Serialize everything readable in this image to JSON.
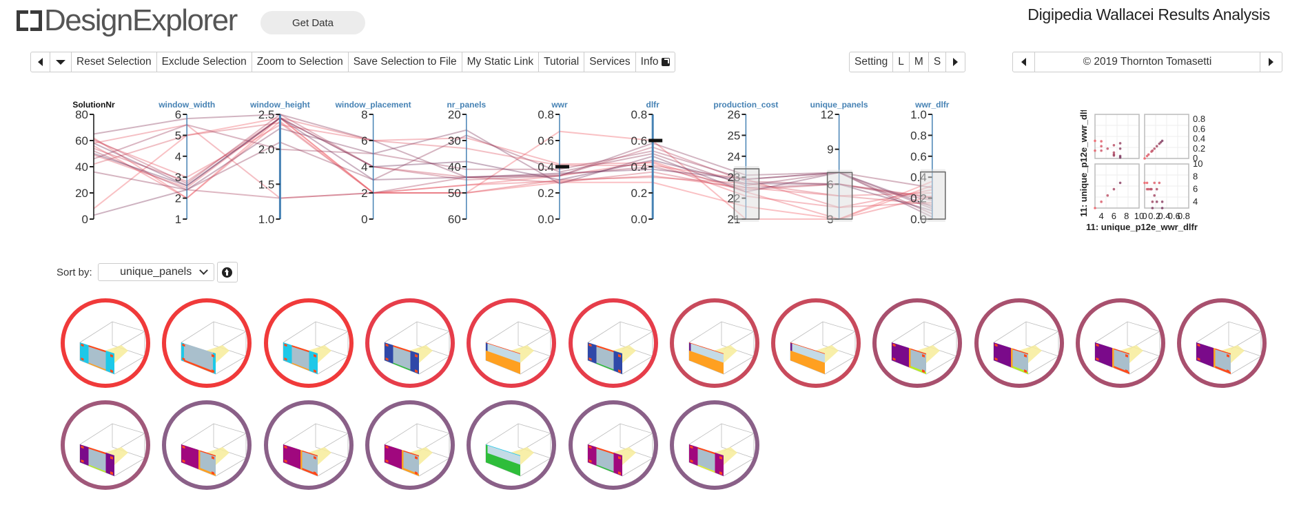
{
  "header": {
    "logo_text": "DesignExplorer",
    "get_data_label": "Get Data",
    "title": "Digipedia Wallacei Results Analysis"
  },
  "toolbar": {
    "items": [
      {
        "name": "prev-button",
        "icon": "triangle-left-icon",
        "label": ""
      },
      {
        "name": "dropdown-button",
        "icon": "triangle-down-icon",
        "label": ""
      },
      {
        "name": "reset-selection-button",
        "label": "Reset Selection"
      },
      {
        "name": "exclude-selection-button",
        "label": "Exclude Selection"
      },
      {
        "name": "zoom-to-selection-button",
        "label": "Zoom to Selection"
      },
      {
        "name": "save-selection-button",
        "label": "Save Selection to File"
      },
      {
        "name": "static-link-button",
        "label": "My Static Link"
      },
      {
        "name": "tutorial-button",
        "label": "Tutorial"
      },
      {
        "name": "services-button",
        "label": "Services"
      },
      {
        "name": "info-button",
        "label": "Info",
        "icon": "external-link-icon"
      }
    ],
    "settings": {
      "setting_label": "Setting",
      "sizes": [
        "L",
        "M",
        "S"
      ]
    },
    "credits": {
      "text": "© 2019 Thornton Tomasetti"
    }
  },
  "chart_data": [
    {
      "type": "parallel-coordinates",
      "axes": [
        {
          "name": "SolutionNr",
          "ticks": [
            "0",
            "20",
            "40",
            "60",
            "80"
          ],
          "range": [
            0,
            80
          ],
          "inverted": false,
          "brush": null
        },
        {
          "name": "window_width",
          "ticks": [
            "1",
            "2",
            "3",
            "4",
            "5",
            "6"
          ],
          "range": [
            1,
            6
          ],
          "inverted": false,
          "brush": null
        },
        {
          "name": "window_height",
          "ticks": [
            "1.0",
            "1.5",
            "2.0",
            "2.5"
          ],
          "range": [
            1.0,
            2.5
          ],
          "inverted": false,
          "brush": null
        },
        {
          "name": "window_placement",
          "ticks": [
            "0",
            "2",
            "4",
            "6",
            "8"
          ],
          "range": [
            0,
            8
          ],
          "inverted": false,
          "brush": null
        },
        {
          "name": "nr_panels",
          "ticks": [
            "60",
            "50",
            "40",
            "30",
            "20"
          ],
          "range": [
            60,
            20
          ],
          "inverted": true,
          "brush": null
        },
        {
          "name": "wwr",
          "ticks": [
            "0.0",
            "0.2",
            "0.4",
            "0.6",
            "0.8"
          ],
          "range": [
            0,
            0.8
          ],
          "inverted": false,
          "brush": null,
          "marker": 0.4
        },
        {
          "name": "dlfr",
          "ticks": [
            "0.0",
            "0.2",
            "0.4",
            "0.6",
            "0.8"
          ],
          "range": [
            0,
            0.8
          ],
          "inverted": false,
          "brush": null,
          "marker": 0.6
        },
        {
          "name": "production_cost",
          "ticks": [
            "21",
            "22",
            "23",
            "24",
            "25",
            "26"
          ],
          "range": [
            21,
            26
          ],
          "inverted": false,
          "brush": [
            21,
            23.4
          ]
        },
        {
          "name": "unique_panels",
          "ticks": [
            "3",
            "6",
            "9",
            "12"
          ],
          "range": [
            3,
            12
          ],
          "inverted": false,
          "brush": [
            3,
            7
          ]
        },
        {
          "name": "wwr_dlfr",
          "ticks": [
            "0.0",
            "0.2",
            "0.4",
            "0.6",
            "0.8",
            "1.0"
          ],
          "range": [
            0,
            1
          ],
          "inverted": false,
          "brush": [
            0,
            0.45
          ]
        }
      ],
      "series": [
        {
          "rank": 0.0,
          "values": [
            62,
            2.0,
            2.45,
            2.0,
            50,
            0.28,
            0.28,
            21.6,
            3,
            0.36
          ]
        },
        {
          "rank": 0.02,
          "values": [
            8,
            5.0,
            2.45,
            2.0,
            50,
            0.67,
            0.6,
            21.0,
            3,
            0.32
          ]
        },
        {
          "rank": 0.05,
          "values": [
            56,
            2.0,
            2.4,
            2.0,
            47,
            0.33,
            0.44,
            22.3,
            3,
            0.22
          ]
        },
        {
          "rank": 0.08,
          "values": [
            60,
            3.0,
            2.35,
            6.0,
            29,
            0.42,
            0.43,
            22.1,
            4,
            0.28
          ]
        },
        {
          "rank": 0.1,
          "values": [
            58,
            5.5,
            1.3,
            2.0,
            47,
            0.29,
            0.33,
            22.5,
            5,
            0.25
          ]
        },
        {
          "rank": 0.14,
          "values": [
            49,
            2.5,
            2.45,
            6.0,
            33,
            0.41,
            0.41,
            22.9,
            4,
            0.16
          ]
        },
        {
          "rank": 0.2,
          "values": [
            42,
            5.0,
            2.38,
            2.0,
            50,
            0.3,
            0.32,
            22.7,
            5,
            0.14
          ]
        },
        {
          "rank": 0.3,
          "values": [
            54,
            2.8,
            2.45,
            4.0,
            44,
            0.28,
            0.36,
            22.4,
            6,
            0.21
          ]
        },
        {
          "rank": 0.45,
          "values": [
            61,
            2.7,
            2.5,
            4.0,
            45,
            0.33,
            0.55,
            22.8,
            6,
            0.2
          ]
        },
        {
          "rank": 0.55,
          "values": [
            52,
            2.4,
            1.3,
            2.0,
            44,
            0.34,
            0.4,
            22.5,
            6,
            0.18
          ]
        },
        {
          "rank": 0.62,
          "values": [
            46,
            5.5,
            2.0,
            5.0,
            41,
            0.38,
            0.52,
            22.9,
            7,
            0.05
          ]
        },
        {
          "rank": 0.7,
          "values": [
            36,
            2.4,
            2.1,
            3.0,
            28,
            0.36,
            0.5,
            22.6,
            7,
            0.3
          ]
        },
        {
          "rank": 0.78,
          "values": [
            65,
            5.8,
            2.5,
            6.0,
            44,
            0.33,
            0.58,
            23.1,
            7,
            0.1
          ]
        },
        {
          "rank": 0.85,
          "values": [
            3,
            2.4,
            2.3,
            5.0,
            26,
            0.27,
            0.48,
            22.3,
            7,
            0.02
          ]
        },
        {
          "rank": 0.92,
          "values": [
            58,
            2.6,
            2.45,
            3.0,
            44,
            0.35,
            0.38,
            22.9,
            7,
            0.12
          ]
        },
        {
          "rank": 1.0,
          "values": [
            50,
            2.6,
            2.45,
            4.0,
            38,
            0.3,
            0.45,
            22.7,
            6,
            0.08
          ]
        }
      ]
    },
    {
      "type": "scatter",
      "title": "scatter-plot-matrix",
      "x_labels": [
        "11: unique_p12e_wwr_dlfr"
      ],
      "y_labels": [
        "11: unique_p12e_wwr_dlfr"
      ],
      "x_ticks_left": [
        "4",
        "6",
        "8",
        "10"
      ],
      "x_ticks_right": [
        "0",
        "0.2",
        "0.4",
        "0.6",
        "0.8"
      ],
      "y_ticks_top": [
        "0",
        "0.2",
        "0.4",
        "0.6",
        "0.8"
      ],
      "y_ticks_bottom": [
        "4",
        "6",
        "8",
        "10"
      ],
      "panels": {
        "top_left": [
          [
            3,
            0.36
          ],
          [
            3,
            0.16
          ],
          [
            4,
            0.35
          ],
          [
            4,
            0.25
          ],
          [
            4,
            0.16
          ],
          [
            5,
            0.2
          ],
          [
            6,
            0.27
          ],
          [
            6,
            0.12
          ],
          [
            6,
            0.08
          ],
          [
            6,
            0.06
          ],
          [
            7,
            0.31
          ],
          [
            7,
            0.2
          ],
          [
            7,
            0.05
          ],
          [
            7,
            0.02
          ]
        ],
        "top_right": [
          [
            0,
            0
          ],
          [
            0.05,
            0.05
          ],
          [
            0.08,
            0.08
          ],
          [
            0.14,
            0.14
          ],
          [
            0.16,
            0.16
          ],
          [
            0.2,
            0.2
          ],
          [
            0.25,
            0.25
          ],
          [
            0.3,
            0.3
          ],
          [
            0.33,
            0.33
          ],
          [
            0.36,
            0.36
          ]
        ],
        "bottom_left": [
          [
            3,
            3
          ],
          [
            4,
            4
          ],
          [
            5,
            5
          ],
          [
            6,
            6
          ],
          [
            7,
            7
          ]
        ],
        "bottom_right": [
          [
            0,
            7
          ],
          [
            0.05,
            7
          ],
          [
            0.2,
            7
          ],
          [
            0.3,
            7
          ],
          [
            0.05,
            6
          ],
          [
            0.08,
            6
          ],
          [
            0.12,
            6
          ],
          [
            0.14,
            6
          ],
          [
            0.25,
            6
          ],
          [
            0.2,
            5
          ],
          [
            0.16,
            4
          ],
          [
            0.25,
            4
          ],
          [
            0.36,
            4
          ],
          [
            0.16,
            3
          ],
          [
            0.36,
            3
          ]
        ]
      }
    }
  ],
  "sort": {
    "label": "Sort by:",
    "selected": "unique_panels",
    "direction_icon": "arrow-circle-up-icon"
  },
  "thumbnails": [
    {
      "ring": "#f03a3a",
      "scheme": {
        "side": "#1ec8e8",
        "glass": "#a9bfcc",
        "accent": "#ff4a1a",
        "bottom": "#ffa020",
        "layout": "sides"
      }
    },
    {
      "ring": "#f03a3a",
      "scheme": {
        "side": "#1ec8e8",
        "glass": "#a9bfcc",
        "accent": "#ff4a1a",
        "bottom": "#ff4a1a",
        "layout": "full"
      }
    },
    {
      "ring": "#f03a3a",
      "scheme": {
        "side": "#1ec8e8",
        "glass": "#a9bfcc",
        "accent": "#ff4a1a",
        "bottom": "#ffa020",
        "layout": "sides"
      }
    },
    {
      "ring": "#e63d4a",
      "scheme": {
        "side": "#2f48a8",
        "glass": "#a9bfcc",
        "accent": "#ff4a1a",
        "bottom": "#2ebd3a",
        "layout": "sides"
      }
    },
    {
      "ring": "#e63d4a",
      "scheme": {
        "side": "#2f48a8",
        "glass": "#c4dbe6",
        "accent": "#ff4a1a",
        "bottom": "#ffa020",
        "layout": "lower"
      }
    },
    {
      "ring": "#e63d4a",
      "scheme": {
        "side": "#2f48a8",
        "glass": "#a9bfcc",
        "accent": "#ff4a1a",
        "bottom": "#2ebd3a",
        "layout": "sides"
      }
    },
    {
      "ring": "#c84a5c",
      "scheme": {
        "side": "#6a1a8a",
        "glass": "#c4dbe6",
        "accent": "#ff4a1a",
        "bottom": "#ffa020",
        "layout": "lower"
      }
    },
    {
      "ring": "#c84a5c",
      "scheme": {
        "side": "#6a1a8a",
        "glass": "#c4dbe6",
        "accent": "#ff4a1a",
        "bottom": "#ffa020",
        "layout": "lower"
      }
    },
    {
      "ring": "#a8506e",
      "scheme": {
        "side": "#7a0a8a",
        "glass": "#a9bfcc",
        "accent": "#ff4a1a",
        "bottom": "#b8f020",
        "layout": "left"
      }
    },
    {
      "ring": "#a8506e",
      "scheme": {
        "side": "#7a0a8a",
        "glass": "#a9bfcc",
        "accent": "#ff4a1a",
        "bottom": "#b8f020",
        "layout": "left"
      }
    },
    {
      "ring": "#a8506e",
      "scheme": {
        "side": "#7a0a8a",
        "glass": "#a9bfcc",
        "accent": "#ff4a1a",
        "bottom": "#ff4a1a",
        "layout": "left"
      }
    },
    {
      "ring": "#a8506e",
      "scheme": {
        "side": "#7a0a8a",
        "glass": "#a9bfcc",
        "accent": "#ff4a1a",
        "bottom": "#ff4a1a",
        "layout": "left"
      }
    },
    {
      "ring": "#a0587a",
      "scheme": {
        "side": "#7a0a8a",
        "glass": "#a9bfcc",
        "accent": "#ff4a1a",
        "bottom": "#b8f020",
        "layout": "sides"
      }
    },
    {
      "ring": "#8a6088",
      "scheme": {
        "side": "#a0087e",
        "glass": "#a9bfcc",
        "accent": "#ff4a1a",
        "bottom": "#ffa020",
        "layout": "left"
      }
    },
    {
      "ring": "#8a6088",
      "scheme": {
        "side": "#a0087e",
        "glass": "#a9bfcc",
        "accent": "#ff4a1a",
        "bottom": "#ff4a1a",
        "layout": "left"
      }
    },
    {
      "ring": "#8a6088",
      "scheme": {
        "side": "#a0087e",
        "glass": "#a9bfcc",
        "accent": "#ff4a1a",
        "bottom": "#ffa020",
        "layout": "left"
      }
    },
    {
      "ring": "#8a6088",
      "scheme": {
        "side": "#2ebd3a",
        "glass": "#c4dbe6",
        "accent": "#1ec8e8",
        "bottom": "#2ebd3a",
        "layout": "lower"
      }
    },
    {
      "ring": "#8a6088",
      "scheme": {
        "side": "#a0087e",
        "glass": "#a9bfcc",
        "accent": "#ff4a1a",
        "bottom": "#2ebd3a",
        "layout": "sides"
      }
    },
    {
      "ring": "#8a6088",
      "scheme": {
        "side": "#a0087e",
        "glass": "#a9bfcc",
        "accent": "#ff4a1a",
        "bottom": "#e8f520",
        "layout": "sides"
      }
    }
  ],
  "colors": {
    "axis_blue": "#4682b4",
    "line_low": "#f25c64",
    "line_high": "#6b2f5a"
  }
}
